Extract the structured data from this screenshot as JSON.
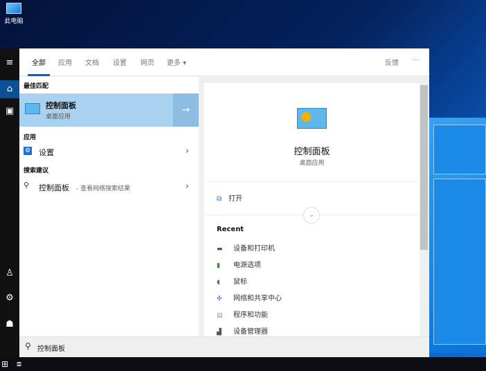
{
  "desktop": {
    "icon_label": "此电脑"
  },
  "tabs": [
    {
      "label": "全部"
    },
    {
      "label": "应用"
    },
    {
      "label": "文档"
    },
    {
      "label": "设置"
    },
    {
      "label": "网页"
    },
    {
      "label": "更多 ▾"
    }
  ],
  "header": {
    "feedback": "反馈",
    "more": "···"
  },
  "left": {
    "best_match_heading": "最佳匹配",
    "best_match": {
      "title": "控制面板",
      "subtitle": "桌面应用",
      "arrow": "→"
    },
    "apps_heading": "应用",
    "apps": [
      {
        "label": "设置"
      }
    ],
    "suggest_heading": "搜索建议",
    "suggestions": [
      {
        "label": "控制面板",
        "suffix": " - 查看网络搜索结果"
      }
    ]
  },
  "right": {
    "title": "控制面板",
    "subtitle": "桌面应用",
    "open_label": "打开",
    "recent_heading": "Recent",
    "recent": [
      {
        "label": "设备和打印机"
      },
      {
        "label": "电源选项"
      },
      {
        "label": "鼠标"
      },
      {
        "label": "网络和共享中心"
      },
      {
        "label": "程序和功能"
      },
      {
        "label": "设备管理器"
      }
    ]
  },
  "search": {
    "value": "控制面板"
  }
}
